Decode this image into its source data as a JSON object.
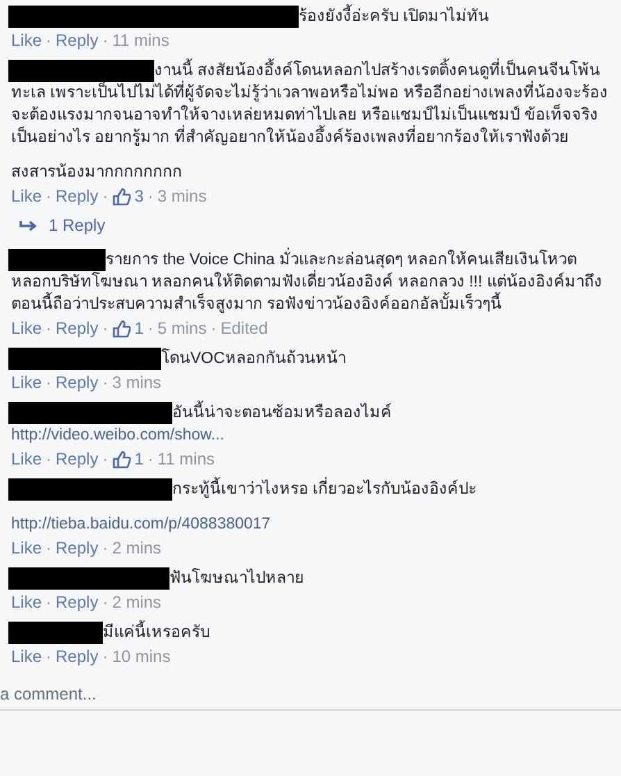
{
  "separator": "·",
  "comments": [
    {
      "redacted": true,
      "paragraphs": [
        [
          {
            "kind": "text",
            "text": "ร้องยังงี้อ่ะครับ เปิดมาไม่ทัน"
          }
        ]
      ],
      "actions": [
        "Like",
        "Reply"
      ],
      "time": "11 mins"
    },
    {
      "redacted": true,
      "paragraphs": [
        [
          {
            "kind": "text",
            "text": "งานนี้ สงสัยน้องอึ้งค์โดนหลอกไปสร้างเรตติ้งคนดูที่เป็นคนจีนโพ้นทะเล เพราะเป็นไปไม่ได้ที่ผู้จัดจะไม่รู้ว่าเวลาพอหรือไม่พอ หรืออีกอย่างเพลงที่น้องจะร้องจะต้องแรงมากจนอาจทำให้จางเหล่ยหมดท่าไปเลย หรือแชมป์ไม่เป็นแชมป์ ข้อเท็จจริงเป็นอย่างไร อยากรู้มาก ที่สำคัญอยากให้น้องอึ้งค์ร้องเพลงที่อยากร้องให้เราฟังด้วย"
          }
        ],
        [
          {
            "kind": "text",
            "text": "สงสารน้องมากกกกกกกก"
          }
        ]
      ],
      "actions": [
        "Like",
        "Reply"
      ],
      "likes": "3",
      "time": "3 mins",
      "replies": "1 Reply"
    },
    {
      "redacted": true,
      "paragraphs": [
        [
          {
            "kind": "text",
            "text": "รายการ the Voice China มั่วและกะล่อนสุดๆ หลอกให้คนเสียเงินโหวต หลอกบริษัทโฆษณา หลอกคนให้ติดตามฟังเดี่ยวน้องอิงค์ หลอกลวง !!! แต่น้องอิงค์มาถึงตอนนี้ถือว่าประสบความสำเร็จสูงมาก รอฟังข่าวน้องอิงค์ออกอัลบั้มเร็วๆนี้"
          }
        ]
      ],
      "actions": [
        "Like",
        "Reply"
      ],
      "likes": "1",
      "time": "5 mins",
      "edited": "Edited"
    },
    {
      "redacted": true,
      "paragraphs": [
        [
          {
            "kind": "text",
            "text": "โดนVOCหลอกกันถ้วนหน้า"
          }
        ]
      ],
      "actions": [
        "Like",
        "Reply"
      ],
      "time": "3 mins"
    },
    {
      "redacted": true,
      "paragraphs": [
        [
          {
            "kind": "text",
            "text": "อันนี้น่าจะตอนซ้อมหรือลองไมค์"
          },
          {
            "kind": "link",
            "text": "http://video.weibo.com/show..."
          }
        ]
      ],
      "actions": [
        "Like",
        "Reply"
      ],
      "likes": "1",
      "time": "11 mins"
    },
    {
      "redacted": true,
      "paragraphs": [
        [
          {
            "kind": "text",
            "text": "กระทู้นี้เขาว่าไงหรอ เกี่ยวอะไรกับน้องอิงค์ปะ"
          }
        ],
        [
          {
            "kind": "link",
            "text": "http://tieba.baidu.com/p/4088380017"
          }
        ]
      ],
      "actions": [
        "Like",
        "Reply"
      ],
      "time": "2 mins"
    },
    {
      "redacted": true,
      "paragraphs": [
        [
          {
            "kind": "text",
            "text": "ฟันโฆษณาไปหลาย"
          }
        ]
      ],
      "actions": [
        "Like",
        "Reply"
      ],
      "time": "2 mins"
    },
    {
      "redacted": true,
      "paragraphs": [
        [
          {
            "kind": "text",
            "text": "มีแค่นี้เหรอครับ"
          }
        ]
      ],
      "actions": [
        "Like",
        "Reply"
      ],
      "time": "10 mins"
    }
  ],
  "composer": {
    "placeholder": "a comment..."
  }
}
